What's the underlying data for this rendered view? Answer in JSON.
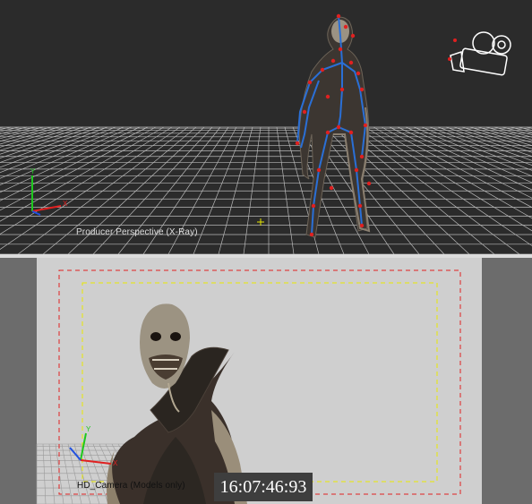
{
  "viewports": {
    "top": {
      "label": "Producer Perspective (X-Ray)",
      "axis": {
        "x": "X",
        "y": "Y"
      }
    },
    "bottom": {
      "label": "HD_Camera (Models only)",
      "timecode": "16:07:46:93",
      "axis": {
        "x": "X",
        "y": "Y"
      }
    }
  },
  "icons": [
    "camera-icon",
    "axis-gizmo-icon",
    "center-crosshair-icon"
  ],
  "colors": {
    "top_background": "#2b2b2b",
    "grid": "#bdbdbd",
    "skeleton_bone": "#2a6fd6",
    "skeleton_joint": "#e02020",
    "camera_area": "#cfcfcf",
    "safe_action_frame": "#e02020",
    "safe_title_frame": "#e8e800",
    "timecode_bg": "#3e3e3e"
  }
}
